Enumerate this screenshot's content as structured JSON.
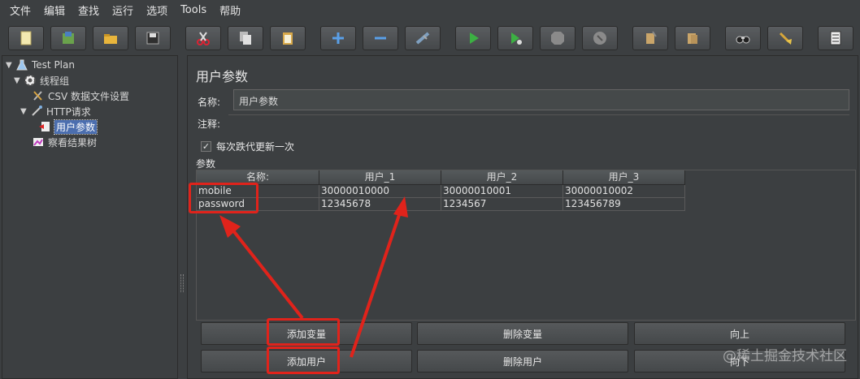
{
  "menu": [
    "文件",
    "编辑",
    "查找",
    "运行",
    "选项",
    "Tools",
    "帮助"
  ],
  "toolbar": [
    {
      "icon": "new-template-icon"
    },
    {
      "icon": "templates-icon"
    },
    {
      "icon": "open-icon"
    },
    {
      "icon": "save-icon"
    },
    {
      "icon": "cut-icon"
    },
    {
      "icon": "copy-icon"
    },
    {
      "icon": "paste-icon"
    },
    {
      "icon": "expand-icon"
    },
    {
      "icon": "collapse-icon"
    },
    {
      "icon": "toggle-icon"
    },
    {
      "icon": "start-icon"
    },
    {
      "icon": "start-no-pause-icon"
    },
    {
      "icon": "stop-icon"
    },
    {
      "icon": "shutdown-icon"
    },
    {
      "icon": "clear-icon"
    },
    {
      "icon": "clear-all-icon"
    },
    {
      "icon": "search-icon"
    },
    {
      "icon": "reset-search-icon"
    },
    {
      "icon": "function-helper-icon"
    }
  ],
  "tree": {
    "test_plan": "Test Plan",
    "thread_group": "线程组",
    "csv_config": "CSV 数据文件设置",
    "http_request": "HTTP请求",
    "user_params": "用户参数",
    "result_tree": "察看结果树"
  },
  "panel": {
    "title": "用户参数",
    "name_label": "名称:",
    "name_value": "用户参数",
    "comment_label": "注释:",
    "update_each_iteration": "每次跌代更新一次",
    "params_label": "参数"
  },
  "table": {
    "headers": [
      "名称:",
      "用户_1",
      "用户_2",
      "用户_3"
    ],
    "rows": [
      [
        "mobile",
        "30000010000",
        "30000010001",
        "30000010002"
      ],
      [
        "password",
        "12345678",
        "1234567",
        "123456789"
      ]
    ]
  },
  "buttons": {
    "add_variable": "添加变量",
    "delete_variable": "删除变量",
    "up": "向上",
    "add_user": "添加用户",
    "delete_user": "删除用户",
    "down": "向下"
  },
  "watermark": "@稀土掘金技术社区",
  "colors": {
    "background": "#3c3f41",
    "selection": "#4b6eaf",
    "highlight": "#e0231b"
  }
}
